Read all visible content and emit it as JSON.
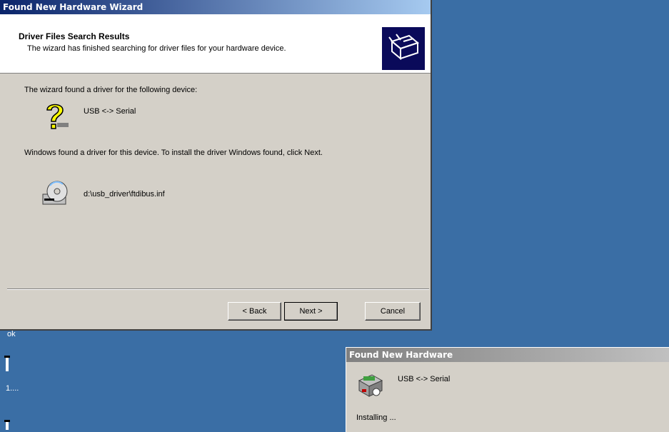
{
  "wizard": {
    "title": "Found New Hardware Wizard",
    "header_title": "Driver Files Search Results",
    "header_subtitle": "The wizard has finished searching for driver files for your hardware device.",
    "found_text": "The wizard found a driver for the following device:",
    "device_name": "USB <-> Serial",
    "install_text": "Windows found a driver for this device. To install the driver Windows found, click Next.",
    "driver_path": "d:\\usb_driver\\ftdibus.inf",
    "buttons": {
      "back": "< Back",
      "next": "Next >",
      "cancel": "Cancel"
    }
  },
  "popup": {
    "title": "Found New Hardware",
    "device_name": "USB <-> Serial",
    "status": "Installing ..."
  },
  "desktop": {
    "fragments": [
      "ok",
      "1...."
    ]
  },
  "colors": {
    "desktop": "#3a6ea5",
    "titlebar_active": "#0a246a",
    "titlebar_inactive": "#808080",
    "window": "#d4d0c8"
  },
  "icons": {
    "header": "hardware-wizard-icon",
    "device": "question-mark-icon",
    "driver": "cd-driver-icon",
    "popup": "hardware-install-icon"
  }
}
